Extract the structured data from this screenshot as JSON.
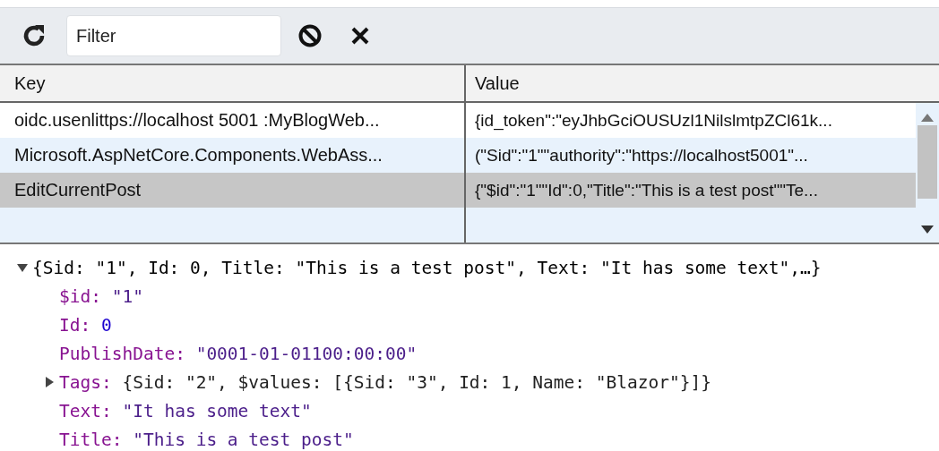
{
  "toolbar": {
    "filter": {
      "placeholder": "Filter"
    }
  },
  "table": {
    "columns": [
      "Key",
      "Value"
    ],
    "rows": [
      {
        "key": "oidc.usenlittps://localhost 5001 :MyBlogWeb...",
        "value": "{id_token\":\"eyJhbGciOUSUzl1NilslmtpZCl61k...",
        "selected": false
      },
      {
        "key": "Microsoft.AspNetCore.Components.WebAss...",
        "value": "(\"Sid\":\"1\"\"authority\":\"https://localhost5001\"...",
        "selected": false
      },
      {
        "key": "EditCurrentPost",
        "value": "{\"$id\":\"1\"\"Id\":0,\"Title\":\"This is a test post\"\"Te...",
        "selected": true
      }
    ]
  },
  "preview": {
    "summary": "{Sid: \"1\", Id: 0, Title: \"This is a test post\", Text: \"It has some text\",…}",
    "expanded": true,
    "properties": [
      {
        "key": "$id:",
        "value": "\"1\"",
        "kind": "string",
        "expandable": false
      },
      {
        "key": "Id:",
        "value": "0",
        "kind": "number",
        "expandable": false
      },
      {
        "key": "PublishDate:",
        "value": "\"0001-01-01100:00:00\"",
        "kind": "string",
        "expandable": false
      },
      {
        "key": "Tags:",
        "value": "{Sid: \"2\", $values: [{Sid: \"3\", Id: 1, Name: \"Blazor\"}]}",
        "kind": "object",
        "expandable": true,
        "expanded": false
      },
      {
        "key": "Text:",
        "value": "\"It has some text\"",
        "kind": "string",
        "expandable": false
      },
      {
        "key": "Title:",
        "value": "\"This is a test post\"",
        "kind": "string",
        "expandable": false
      }
    ]
  }
}
